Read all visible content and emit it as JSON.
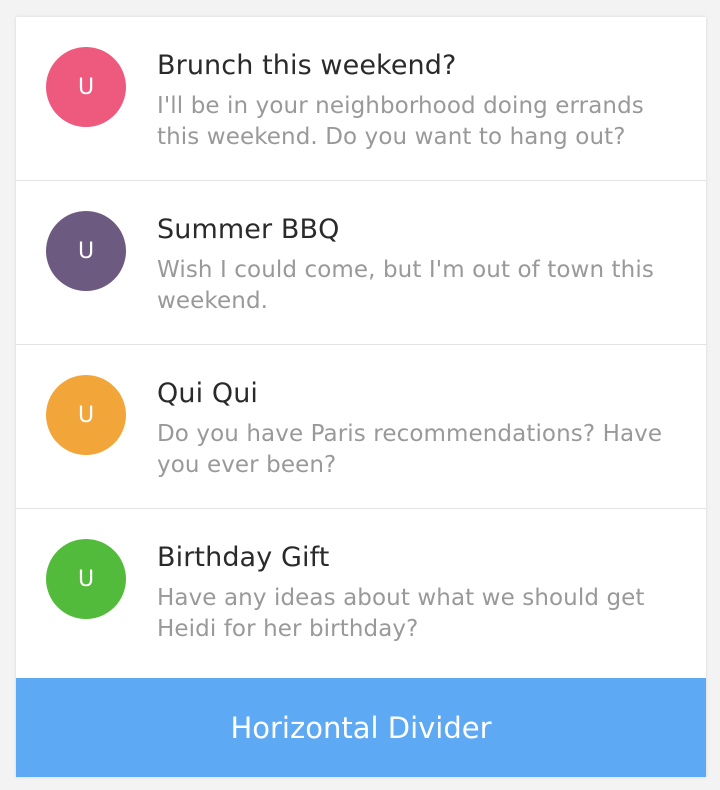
{
  "conversations": [
    {
      "avatar_letter": "U",
      "avatar_color": "#ee5a7e",
      "title": "Brunch this weekend?",
      "message": "I'll be in your neighborhood doing errands this weekend. Do you want to hang out?"
    },
    {
      "avatar_letter": "U",
      "avatar_color": "#6c5a80",
      "title": "Summer BBQ",
      "message": "Wish I could come, but I'm out of town this weekend."
    },
    {
      "avatar_letter": "U",
      "avatar_color": "#f2a63a",
      "title": "Qui Qui",
      "message": "Do you have Paris recommendations? Have you ever been?"
    },
    {
      "avatar_letter": "U",
      "avatar_color": "#53bb3b",
      "title": "Birthday Gift",
      "message": "Have any ideas about what we should get Heidi for her birthday?"
    }
  ],
  "divider_button": {
    "label": "Horizontal Divider",
    "color": "#5ea9f4"
  }
}
